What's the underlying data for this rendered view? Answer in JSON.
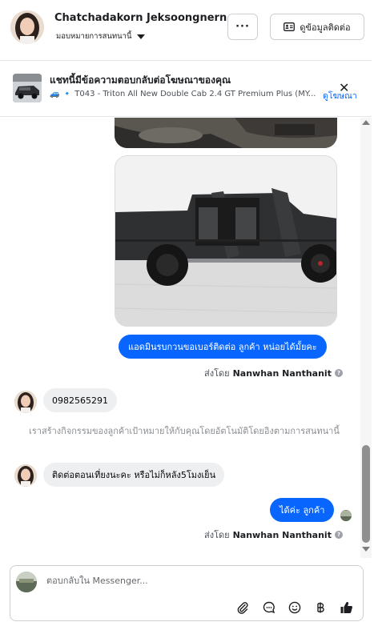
{
  "header": {
    "contact_name": "Chatchadakorn Jeksoongnern",
    "assign_label": "มอบหมายการสนทนานี้",
    "more_label": "···",
    "contact_info_label": "ดูข้อมูลติดต่อ"
  },
  "ad_banner": {
    "title": "แชทนี้มีข้อความตอบกลับต่อโฆษณาของคุณ",
    "subtitle": "🚙 🔹 T043 - Triton All New Double Cab 2.4 GT Premium Plus (MY...",
    "view_ad_label": "ดูโฆษณา",
    "close_icon": "close-icon"
  },
  "messages": {
    "agent_msg_1": "แอดมินรบกวนขอเบอร์ติดต่อ ลูกค้า หน่อยได้มั้ยคะ",
    "sent_by_label": "ส่งโดย",
    "agent_name": "Nanwhan Nanthanit",
    "customer_msg_1": "0982565291",
    "system_notice": "เราสร้างกิจกรรมของลูกค้าเป้าหมายให้กับคุณโดยอัตโนมัติโดยอิงตามการสนทนานี้",
    "customer_msg_2": "ติดต่อตอนเที่ยงนะคะ หรือไม่ก็หลัง5โมงเย็น",
    "agent_msg_2": "ได้ค่ะ ลูกค้า"
  },
  "composer": {
    "placeholder": "ตอบกลับใน Messenger...",
    "tools": [
      "paperclip-icon",
      "chat-bubble-icon",
      "emoji-icon",
      "baht-icon",
      "thumbs-up-icon"
    ]
  },
  "colors": {
    "accent": "#0866ff",
    "bubble_gray": "#eeeff1",
    "muted_text": "#8a8d91"
  }
}
